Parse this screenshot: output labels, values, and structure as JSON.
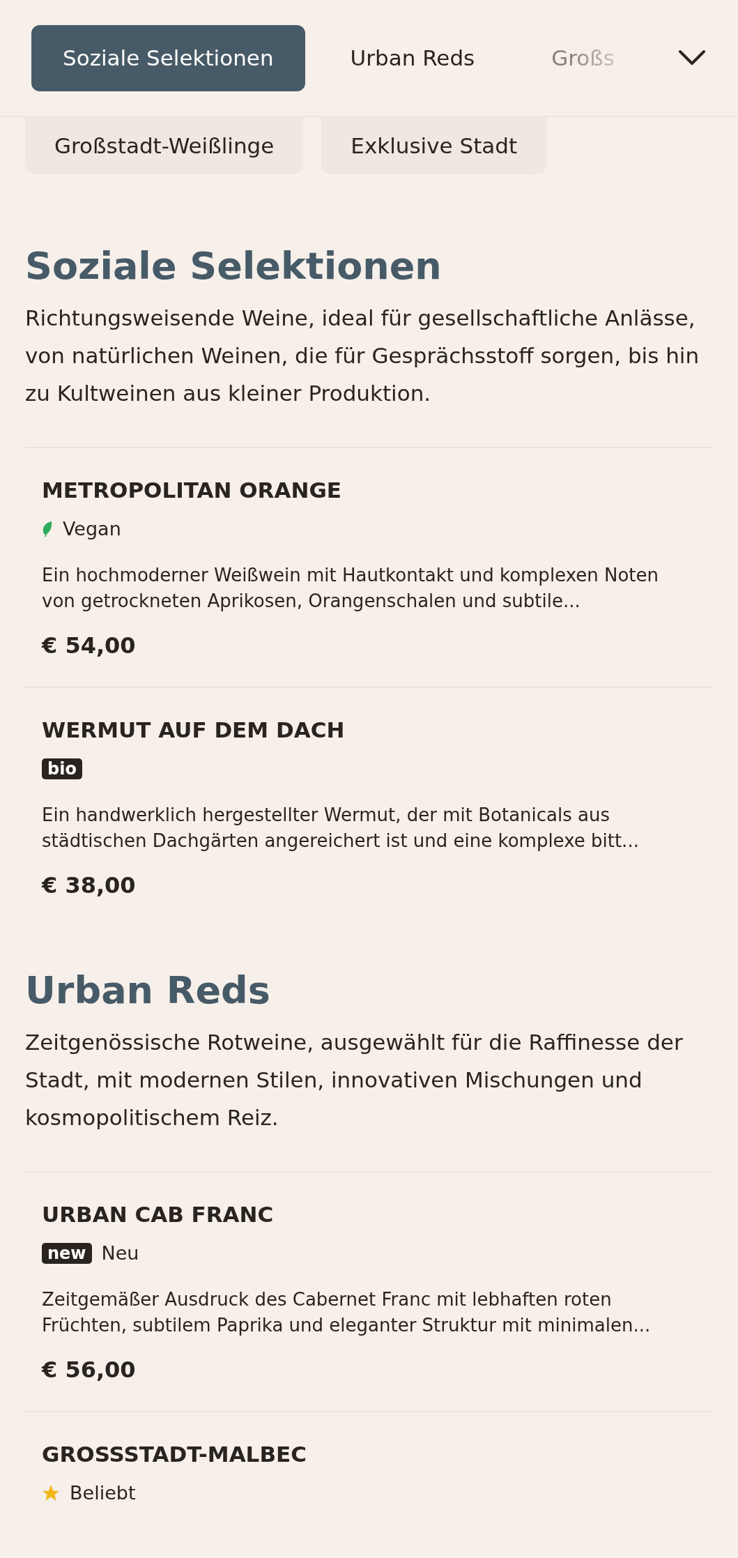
{
  "tabs": [
    {
      "label": "Soziale Selektionen",
      "selected": true
    },
    {
      "label": "Urban Reds",
      "selected": false
    },
    {
      "label": "Großs",
      "selected": false,
      "faded": true
    }
  ],
  "more_tabs": [
    {
      "label": "Großstadt-Weißlinge",
      "selected": false
    },
    {
      "label": "Exklusive Stadt",
      "selected": false
    }
  ],
  "sections": [
    {
      "title": "Soziale Selektionen",
      "description": "Richtungsweisende Weine, ideal für gesellschaftliche Anlässe, von natürlichen Weinen, die für Gesprächsstoff sorgen, bis hin zu Kultweinen aus kleiner Produktion.",
      "items": [
        {
          "name": "METROPOLITAN ORANGE",
          "tag": {
            "kind": "leaf",
            "label": "Vegan"
          },
          "description": "Ein hochmoderner Weißwein mit Hautkontakt und komplexen Noten von getrockneten Aprikosen, Orangenschalen und subtile...",
          "price": "€ 54,00"
        },
        {
          "name": "WERMUT AUF DEM DACH",
          "tag": {
            "kind": "badge",
            "badge": "bio"
          },
          "description": "Ein handwerklich hergestellter Wermut, der mit Botanicals aus städtischen Dachgärten angereichert ist und eine komplexe bitt...",
          "price": "€ 38,00"
        }
      ]
    },
    {
      "title": "Urban Reds",
      "description": "Zeitgenössische Rotweine, ausgewählt für die Raffinesse der Stadt, mit modernen Stilen, innovativen Mischungen und kosmopolitischem Reiz.",
      "items": [
        {
          "name": "URBAN CAB FRANC",
          "tag": {
            "kind": "badge",
            "badge": "new",
            "label": "Neu"
          },
          "description": "Zeitgemäßer Ausdruck des Cabernet Franc mit lebhaften roten Früchten, subtilem Paprika und eleganter Struktur mit minimalen...",
          "price": "€ 56,00"
        },
        {
          "name": "GROSSSTADT-MALBEC",
          "tag": {
            "kind": "star",
            "label": "Beliebt"
          }
        }
      ]
    }
  ]
}
